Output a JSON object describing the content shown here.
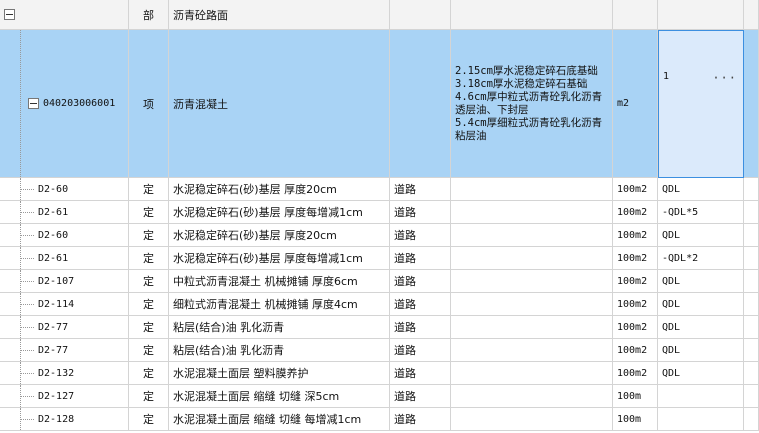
{
  "rows": [
    {
      "code": "",
      "type": "部",
      "name": "沥青砼路面",
      "spec": "",
      "desc": "",
      "unit": "",
      "qty": "",
      "toggle": true
    },
    {
      "code": "040203006001",
      "type": "项",
      "name": "沥青混凝土",
      "spec": "",
      "desc_lines": [
        "2.15cm厚水泥稳定碎石底基础",
        "3.18cm厚水泥稳定碎石基础",
        "4.6cm厚中粒式沥青砼乳化沥青透层油、下封层",
        "5.4cm厚细粒式沥青砼乳化沥青粘层油"
      ],
      "unit": "m2",
      "qty": "1",
      "ellipsis": "···",
      "toggle": true
    },
    {
      "code": "D2-60",
      "type": "定",
      "name": "水泥稳定碎石(砂)基层 厚度20cm",
      "spec": "道路",
      "unit": "100m2",
      "qty": "QDL"
    },
    {
      "code": "D2-61",
      "type": "定",
      "name": "水泥稳定碎石(砂)基层 厚度每增减1cm",
      "spec": "道路",
      "unit": "100m2",
      "qty": "-QDL*5"
    },
    {
      "code": "D2-60",
      "type": "定",
      "name": "水泥稳定碎石(砂)基层 厚度20cm",
      "spec": "道路",
      "unit": "100m2",
      "qty": "QDL"
    },
    {
      "code": "D2-61",
      "type": "定",
      "name": "水泥稳定碎石(砂)基层 厚度每增减1cm",
      "spec": "道路",
      "unit": "100m2",
      "qty": "-QDL*2"
    },
    {
      "code": "D2-107",
      "type": "定",
      "name": "中粒式沥青混凝土 机械摊铺 厚度6cm",
      "spec": "道路",
      "unit": "100m2",
      "qty": "QDL"
    },
    {
      "code": "D2-114",
      "type": "定",
      "name": "细粒式沥青混凝土 机械摊铺 厚度4cm",
      "spec": "道路",
      "unit": "100m2",
      "qty": "QDL"
    },
    {
      "code": "D2-77",
      "type": "定",
      "name": "粘层(结合)油 乳化沥青",
      "spec": "道路",
      "unit": "100m2",
      "qty": "QDL"
    },
    {
      "code": "D2-77",
      "type": "定",
      "name": "粘层(结合)油 乳化沥青",
      "spec": "道路",
      "unit": "100m2",
      "qty": "QDL"
    },
    {
      "code": "D2-132",
      "type": "定",
      "name": "水泥混凝土面层 塑料膜养护",
      "spec": "道路",
      "unit": "100m2",
      "qty": "QDL"
    },
    {
      "code": "D2-127",
      "type": "定",
      "name": "水泥混凝土面层 缩缝 切缝 深5cm",
      "spec": "道路",
      "unit": "100m",
      "qty": ""
    },
    {
      "code": "D2-128",
      "type": "定",
      "name": "水泥混凝土面层 缩缝 切缝 每增减1cm",
      "spec": "道路",
      "unit": "100m",
      "qty": ""
    }
  ]
}
